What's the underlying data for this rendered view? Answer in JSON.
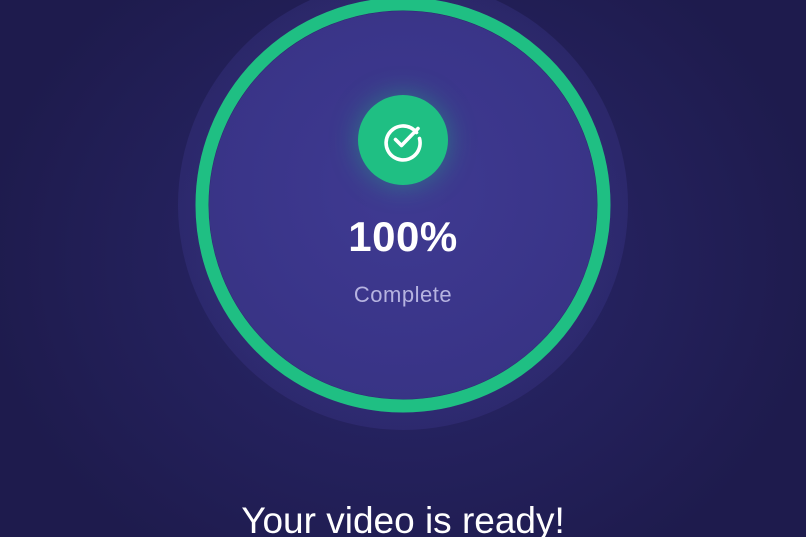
{
  "progress": {
    "value": 1.0,
    "percent_label": "100%",
    "status_label": "Complete",
    "ring_color": "#1fbf83"
  },
  "badge": {
    "icon": "check-circle-icon",
    "color": "#1fbf83"
  },
  "message": {
    "headline": "Your video is ready!"
  },
  "theme": {
    "background": "#1e1b4d",
    "disc": "#3a3589",
    "accent": "#1fbf83",
    "text_primary": "#ffffff",
    "text_secondary": "#b6b3e0"
  }
}
